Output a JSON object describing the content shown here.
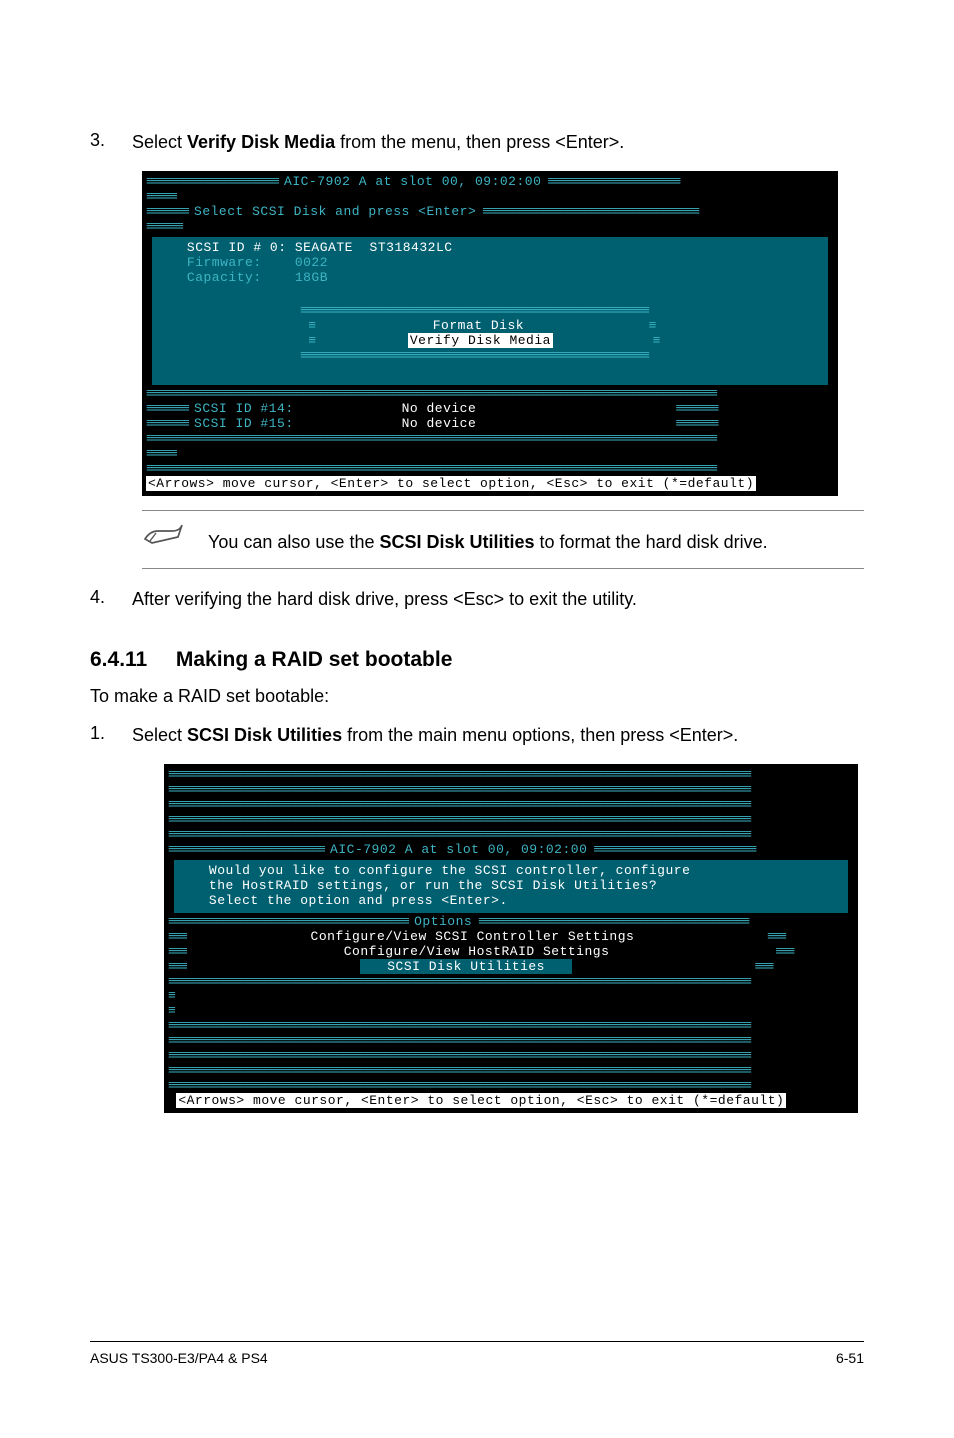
{
  "step3": {
    "num": "3.",
    "prefix": "Select ",
    "bold": "Verify Disk Media",
    "suffix": " from the menu, then press <Enter>."
  },
  "terminal1": {
    "title_border_l": "≡≡≡≡≡≡≡≡≡≡≡≡≡≡≡≡≡≡≡≡≡≡ ",
    "title_text": "AIC-7902 A at slot 00, 09:02:00",
    "title_border_r": " ≡≡≡≡≡≡≡≡≡≡≡≡≡≡≡≡≡≡≡≡≡≡",
    "subtitle": "Select SCSI Disk and press <Enter>",
    "scsi0": "SCSI ID # 0: SEAGATE  ST318432LC",
    "firmware": "Firmware:    0022",
    "capacity": "Capacity:    18GB",
    "format_disk": "Format Disk",
    "verify_disk": "Verify Disk Media",
    "scsi14": "SCSI ID #14:",
    "scsi15": "SCSI ID #15:",
    "nodev": "No device",
    "footer": "<Arrows> move cursor, <Enter> to select option, <Esc> to exit (*=default)"
  },
  "note": {
    "prefix": "You can also use the ",
    "bold": "SCSI Disk Utilities",
    "suffix": " to format the hard disk drive."
  },
  "step4": {
    "num": "4.",
    "text": "After verifying the hard disk drive, press <Esc> to exit the utility."
  },
  "heading": {
    "num": "6.4.11",
    "title": "Making a RAID set bootable"
  },
  "intro": "To make a RAID set bootable:",
  "step1b": {
    "num": "1.",
    "prefix": "Select ",
    "bold": "SCSI Disk Utilities",
    "suffix": " from the main menu options, then press <Enter>."
  },
  "terminal2": {
    "title": "AIC-7902 A at slot 00, 09:02:00",
    "q1": "Would you like to configure the SCSI controller, configure",
    "q2": "the HostRAID settings, or run the SCSI Disk Utilities?",
    "q3": "Select the option and press <Enter>.",
    "opt_header": "Options",
    "opt1": "Configure/View SCSI Controller Settings",
    "opt2": "Configure/View HostRAID Settings",
    "opt3": "SCSI Disk Utilities",
    "footer": "<Arrows> move cursor, <Enter> to select option, <Esc> to exit (*=default)"
  },
  "footer": {
    "left": "ASUS TS300-E3/PA4 & PS4",
    "right": "6-51"
  }
}
